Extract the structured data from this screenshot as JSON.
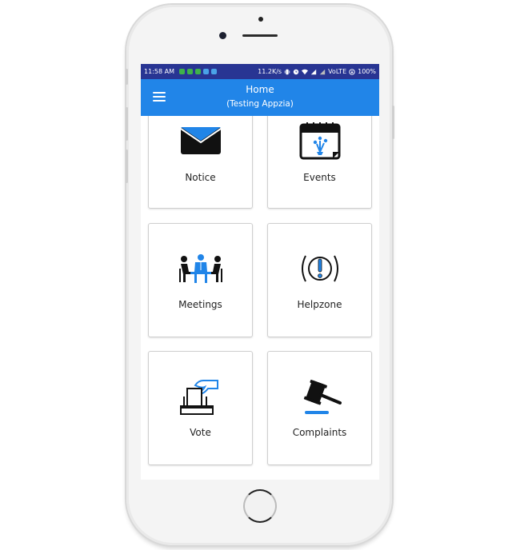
{
  "status_bar": {
    "time": "11:58 AM",
    "notification_icons": [
      "#3fb24a",
      "#3fb24a",
      "#3fb24a",
      "#4aa3e8",
      "#4aa3e8"
    ],
    "network_speed": "11.2K/s",
    "network_type": "VoLTE",
    "battery": "100%",
    "icons": [
      "vibrate-icon",
      "alarm-icon",
      "wifi-icon",
      "signal-icon",
      "signal-icon",
      "battery-saver-icon"
    ]
  },
  "app_bar": {
    "title": "Home",
    "subtitle": "(Testing Appzia)",
    "menu_icon": "hamburger-menu-icon",
    "color": "#2185e8"
  },
  "colors": {
    "status_bar": "#283593",
    "accent": "#2185e8",
    "icon_dark": "#111111"
  },
  "tiles": [
    {
      "label": "Notice",
      "icon": "envelope-icon"
    },
    {
      "label": "Events",
      "icon": "calendar-fireworks-icon"
    },
    {
      "label": "Meetings",
      "icon": "meeting-people-icon"
    },
    {
      "label": "Helpzone",
      "icon": "alert-exclamation-icon"
    },
    {
      "label": "Vote",
      "icon": "ballot-box-icon"
    },
    {
      "label": "Complaints",
      "icon": "gavel-icon"
    }
  ]
}
